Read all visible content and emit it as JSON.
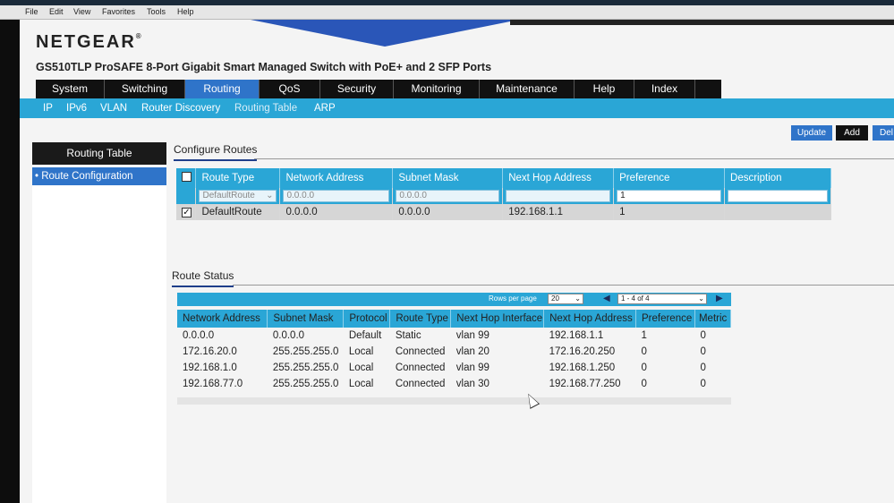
{
  "browser_menu": [
    "File",
    "Edit",
    "View",
    "Favorites",
    "Tools",
    "Help"
  ],
  "brand": {
    "logo": "NETGEAR",
    "trademark": "®",
    "product": "GS510TLP ProSAFE 8-Port Gigabit Smart Managed Switch with PoE+ and 2 SFP Ports"
  },
  "main_tabs": [
    "System",
    "Switching",
    "Routing",
    "QoS",
    "Security",
    "Monitoring",
    "Maintenance",
    "Help",
    "Index"
  ],
  "active_main_tab": "Routing",
  "sub_tabs": [
    "IP",
    "IPv6",
    "VLAN",
    "Router Discovery",
    "Routing Table",
    "ARP"
  ],
  "active_sub_tab": "Routing Table",
  "actions": {
    "update": "Update",
    "add": "Add",
    "delete": "Del"
  },
  "sidebar": {
    "header": "Routing Table",
    "items": [
      "Route Configuration"
    ]
  },
  "configure_routes": {
    "title": "Configure Routes",
    "columns": [
      "Route Type",
      "Network Address",
      "Subnet Mask",
      "Next Hop Address",
      "Preference",
      "Description"
    ],
    "input_row": {
      "route_type": "DefaultRoute",
      "network_address": "0.0.0.0",
      "subnet_mask": "0.0.0.0",
      "next_hop": "",
      "preference": "1",
      "description": ""
    },
    "rows": [
      {
        "checked": true,
        "route_type": "DefaultRoute",
        "network_address": "0.0.0.0",
        "subnet_mask": "0.0.0.0",
        "next_hop": "192.168.1.1",
        "preference": "1",
        "description": ""
      }
    ]
  },
  "route_status": {
    "title": "Route Status",
    "pager": {
      "rows_per_page_label": "Rows per page",
      "rows_per_page": "20",
      "range": "1 - 4 of 4"
    },
    "columns": [
      "Network Address",
      "Subnet Mask",
      "Protocol",
      "Route Type",
      "Next Hop Interface",
      "Next Hop Address",
      "Preference",
      "Metric"
    ],
    "rows": [
      [
        "0.0.0.0",
        "0.0.0.0",
        "Default",
        "Static",
        "vlan 99",
        "192.168.1.1",
        "1",
        "0"
      ],
      [
        "172.16.20.0",
        "255.255.255.0",
        "Local",
        "Connected",
        "vlan 20",
        "172.16.20.250",
        "0",
        "0"
      ],
      [
        "192.168.1.0",
        "255.255.255.0",
        "Local",
        "Connected",
        "vlan 99",
        "192.168.1.250",
        "0",
        "0"
      ],
      [
        "192.168.77.0",
        "255.255.255.0",
        "Local",
        "Connected",
        "vlan 30",
        "192.168.77.250",
        "0",
        "0"
      ]
    ]
  },
  "colors": {
    "accent_blue": "#2aa6d6",
    "active_tab": "#2f74c9",
    "nav_dark": "#111111"
  }
}
